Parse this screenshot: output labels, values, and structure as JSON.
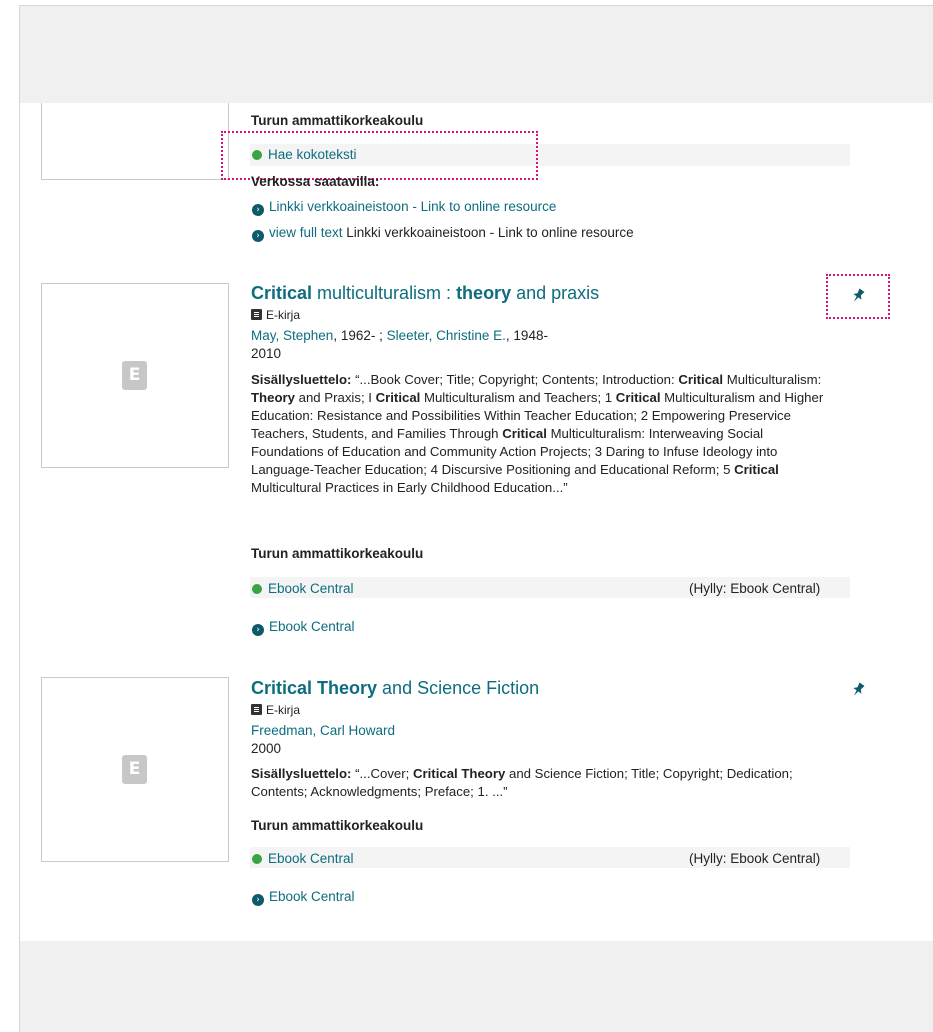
{
  "records": [
    {
      "institution": "Turun ammattikorkeakoulu",
      "fulltext_link": "Hae kokoteksti",
      "online_label": "Verkossa saatavilla:",
      "online_links": [
        {
          "prefix": "",
          "text": "Linkki verkkoaineistoon - Link to online resource"
        },
        {
          "prefix": "view full text",
          "text": " Linkki verkkoaineistoon - Link to online resource"
        }
      ]
    },
    {
      "title_parts": [
        {
          "text": "Critical",
          "bold": true
        },
        {
          "text": " multiculturalism : ",
          "bold": false
        },
        {
          "text": "theory",
          "bold": true
        },
        {
          "text": " and praxis",
          "bold": false
        }
      ],
      "format": "E-kirja",
      "author1": "May, Stephen",
      "author1_years": ", 1962- ; ",
      "author2": "Sleeter, Christine E.",
      "author2_years": ", 1948-",
      "year": "2010",
      "toc_label": "Sisällysluettelo:",
      "toc_text": "“...Book Cover; Title; Copyright; Contents; Introduction: Critical Multiculturalism: Theory and Praxis; I Critical Multiculturalism and Teachers; 1 Critical Multiculturalism and Higher Education: Resistance and Possibilities Within Teacher Education; 2 Empowering Preservice Teachers, Students, and Families Through Critical Multiculturalism: Interweaving Social Foundations of Education and Community Action Projects; 3 Daring to Infuse Ideology into Language-Teacher Education; 4 Discursive Positioning and Educational Reform; 5 Critical Multicultural Practices in Early Childhood Education...”",
      "institution": "Turun ammattikorkeakoulu",
      "availability": "Ebook Central",
      "shelf": "(Hylly: Ebook Central)",
      "link": "Ebook Central"
    },
    {
      "title_parts": [
        {
          "text": "Critical Theory",
          "bold": true
        },
        {
          "text": " and Science Fiction",
          "bold": false
        }
      ],
      "format": "E-kirja",
      "author1": "Freedman, Carl Howard",
      "year": "2000",
      "toc_label": "Sisällysluettelo:",
      "toc_text": "“...Cover; Critical Theory and Science Fiction; Title; Copyright; Dedication; Contents; Acknowledgments; Preface; 1. ...”",
      "institution": "Turun ammattikorkeakoulu",
      "availability": "Ebook Central",
      "shelf": "(Hylly: Ebook Central)",
      "link": "Ebook Central"
    }
  ],
  "thumb_letter": "E",
  "icons": {
    "pin": "pin-icon",
    "book": "ebook-format-icon",
    "arrow": "arrow-circle-right-icon",
    "dot": "available-dot-icon"
  },
  "colors": {
    "link": "#0d6d7f",
    "available": "#3aa344",
    "focus": "#d4147a"
  }
}
